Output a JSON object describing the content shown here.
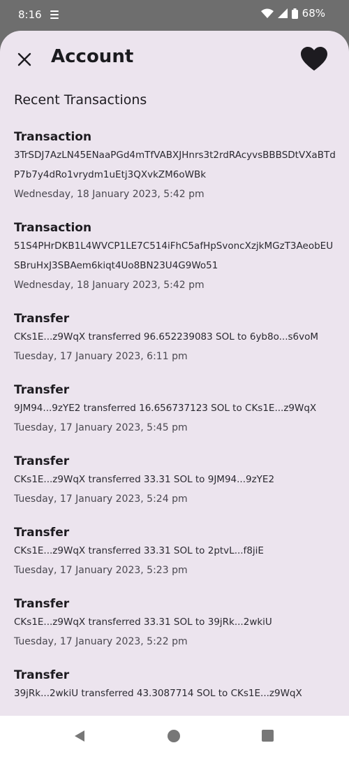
{
  "status": {
    "time": "8:16",
    "battery": "68%"
  },
  "header": {
    "title": "Account"
  },
  "section": {
    "title": "Recent Transactions"
  },
  "transactions": [
    {
      "title": "Transaction",
      "body": "3TrSDJ7AzLN45ENaaPGd4mTfVABXJHnrs3t2rdRAcyvsBBBSDtVXaBTdP7b7y4dRo1vrydm1uEtj3QXvkZM6oWBk",
      "date": "Wednesday, 18 January 2023, 5:42 pm"
    },
    {
      "title": "Transaction",
      "body": "51S4PHrDKB1L4WVCP1LE7C514iFhC5afHpSvoncXzjkMGzT3AeobEUSBruHxJ3SBAem6kiqt4Uo8BN23U4G9Wo51",
      "date": "Wednesday, 18 January 2023, 5:42 pm"
    },
    {
      "title": "Transfer",
      "body": "CKs1E...z9WqX transferred 96.652239083 SOL to 6yb8o...s6voM",
      "date": "Tuesday, 17 January 2023, 6:11 pm"
    },
    {
      "title": "Transfer",
      "body": "9JM94...9zYE2 transferred 16.656737123 SOL to CKs1E...z9WqX",
      "date": "Tuesday, 17 January 2023, 5:45 pm"
    },
    {
      "title": "Transfer",
      "body": "CKs1E...z9WqX transferred 33.31 SOL to 9JM94...9zYE2",
      "date": "Tuesday, 17 January 2023, 5:24 pm"
    },
    {
      "title": "Transfer",
      "body": "CKs1E...z9WqX transferred 33.31 SOL to 2ptvL...f8jiE",
      "date": "Tuesday, 17 January 2023, 5:23 pm"
    },
    {
      "title": "Transfer",
      "body": "CKs1E...z9WqX transferred 33.31 SOL to 39jRk...2wkiU",
      "date": "Tuesday, 17 January 2023, 5:22 pm"
    },
    {
      "title": "Transfer",
      "body": "39jRk...2wkiU transferred 43.3087714 SOL to CKs1E...z9WqX",
      "date": ""
    }
  ],
  "icons": {
    "close": "close-icon",
    "favorite": "heart-icon",
    "back": "back-icon",
    "home": "home-icon",
    "recents": "recents-icon"
  },
  "colors": {
    "sheet": "#ece4ee",
    "text": "#1d1b20",
    "overlay": "#6e6e6e"
  }
}
